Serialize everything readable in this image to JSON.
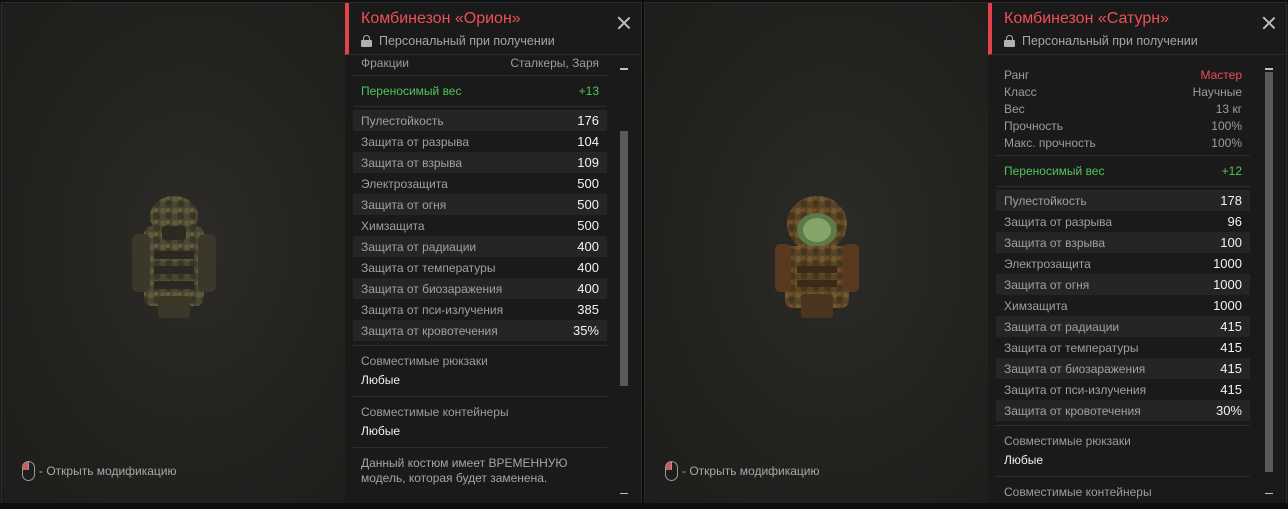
{
  "hint": {
    "open_mod": "- Открыть модификацию"
  },
  "left": {
    "title": "Комбинезон «Орион»",
    "subtitle": "Персональный при получении",
    "factions": {
      "label": "Фракции",
      "value": "Сталкеры, Заря"
    },
    "carry_weight": {
      "label": "Переносимый вес",
      "value": "+13"
    },
    "stats": [
      {
        "label": "Пулестойкость",
        "value": "176"
      },
      {
        "label": "Защита от разрыва",
        "value": "104"
      },
      {
        "label": "Защита от взрыва",
        "value": "109"
      },
      {
        "label": "Электрозащита",
        "value": "500"
      },
      {
        "label": "Защита от огня",
        "value": "500"
      },
      {
        "label": "Химзащита",
        "value": "500"
      },
      {
        "label": "Защита от радиации",
        "value": "400"
      },
      {
        "label": "Защита от температуры",
        "value": "400"
      },
      {
        "label": "Защита от биозаражения",
        "value": "400"
      },
      {
        "label": "Защита от пси-излучения",
        "value": "385"
      },
      {
        "label": "Защита от кровотечения",
        "value": "35%"
      }
    ],
    "backpacks": {
      "label": "Совместимые рюкзаки",
      "value": "Любые"
    },
    "containers": {
      "label": "Совместимые контейнеры",
      "value": "Любые"
    },
    "note": "Данный костюм имеет ВРЕМЕННУЮ модель, которая будет заменена."
  },
  "right": {
    "title": "Комбинезон «Сатурн»",
    "subtitle": "Персональный при получении",
    "info": [
      {
        "label": "Ранг",
        "value": "Мастер"
      },
      {
        "label": "Класс",
        "value": "Научные"
      },
      {
        "label": "Вес",
        "value": "13 кг"
      },
      {
        "label": "Прочность",
        "value": "100%"
      },
      {
        "label": "Макс. прочность",
        "value": "100%"
      }
    ],
    "carry_weight": {
      "label": "Переносимый вес",
      "value": "+12"
    },
    "stats": [
      {
        "label": "Пулестойкость",
        "value": "178"
      },
      {
        "label": "Защита от разрыва",
        "value": "96"
      },
      {
        "label": "Защита от взрыва",
        "value": "100"
      },
      {
        "label": "Электрозащита",
        "value": "1000"
      },
      {
        "label": "Защита от огня",
        "value": "1000"
      },
      {
        "label": "Химзащита",
        "value": "1000"
      },
      {
        "label": "Защита от радиации",
        "value": "415"
      },
      {
        "label": "Защита от температуры",
        "value": "415"
      },
      {
        "label": "Защита от биозаражения",
        "value": "415"
      },
      {
        "label": "Защита от пси-излучения",
        "value": "415"
      },
      {
        "label": "Защита от кровотечения",
        "value": "30%"
      }
    ],
    "backpacks": {
      "label": "Совместимые рюкзаки",
      "value": "Любые"
    },
    "containers": {
      "label": "Совместимые контейнеры"
    }
  }
}
